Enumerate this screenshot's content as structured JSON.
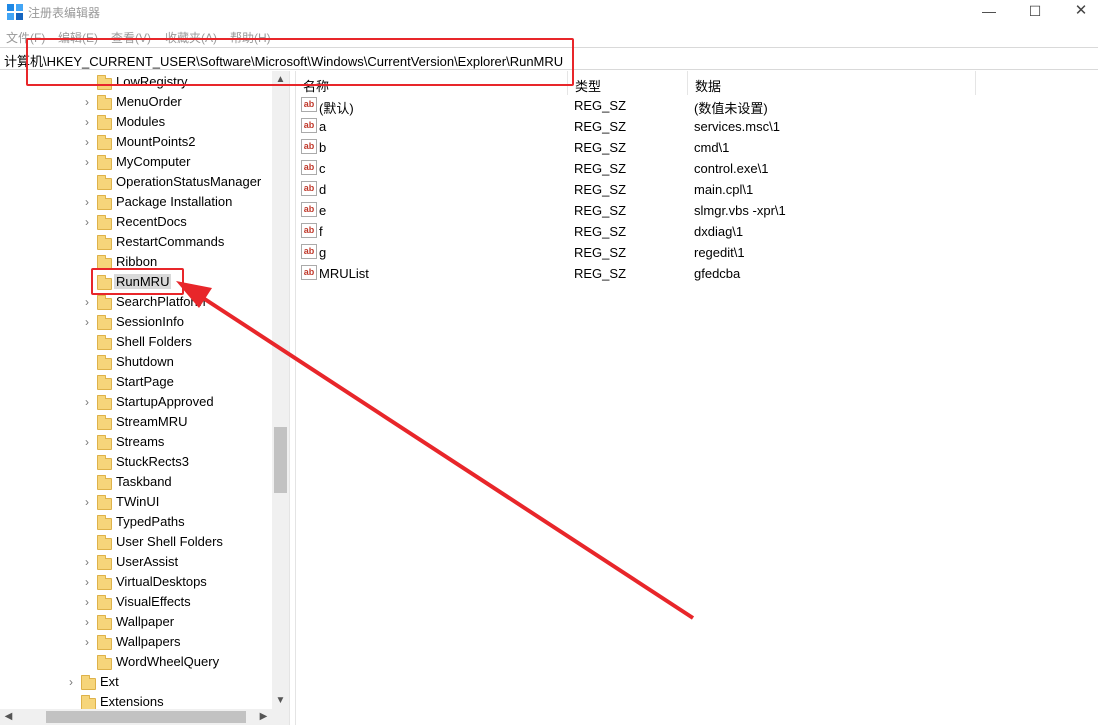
{
  "window": {
    "title": "注册表编辑器",
    "controls": {
      "minimize": "—",
      "maximize": "☐",
      "close": "✕"
    }
  },
  "menu": [
    "文件(F)",
    "编辑(E)",
    "查看(V)",
    "收藏夹(A)",
    "帮助(H)"
  ],
  "address": "计算机\\HKEY_CURRENT_USER\\Software\\Microsoft\\Windows\\CurrentVersion\\Explorer\\RunMRU",
  "tree": {
    "items": [
      {
        "label": "LowRegistry",
        "expandable": false
      },
      {
        "label": "MenuOrder",
        "expandable": true
      },
      {
        "label": "Modules",
        "expandable": true
      },
      {
        "label": "MountPoints2",
        "expandable": true
      },
      {
        "label": "MyComputer",
        "expandable": true
      },
      {
        "label": "OperationStatusManager",
        "expandable": false
      },
      {
        "label": "Package Installation",
        "expandable": true
      },
      {
        "label": "RecentDocs",
        "expandable": true
      },
      {
        "label": "RestartCommands",
        "expandable": false
      },
      {
        "label": "Ribbon",
        "expandable": false
      },
      {
        "label": "RunMRU",
        "expandable": false,
        "selected": true
      },
      {
        "label": "SearchPlatform",
        "expandable": true
      },
      {
        "label": "SessionInfo",
        "expandable": true
      },
      {
        "label": "Shell Folders",
        "expandable": false
      },
      {
        "label": "Shutdown",
        "expandable": false
      },
      {
        "label": "StartPage",
        "expandable": false
      },
      {
        "label": "StartupApproved",
        "expandable": true
      },
      {
        "label": "StreamMRU",
        "expandable": false
      },
      {
        "label": "Streams",
        "expandable": true
      },
      {
        "label": "StuckRects3",
        "expandable": false
      },
      {
        "label": "Taskband",
        "expandable": false
      },
      {
        "label": "TWinUI",
        "expandable": true
      },
      {
        "label": "TypedPaths",
        "expandable": false
      },
      {
        "label": "User Shell Folders",
        "expandable": false
      },
      {
        "label": "UserAssist",
        "expandable": true
      },
      {
        "label": "VirtualDesktops",
        "expandable": true
      },
      {
        "label": "VisualEffects",
        "expandable": true
      },
      {
        "label": "Wallpaper",
        "expandable": true
      },
      {
        "label": "Wallpapers",
        "expandable": true
      },
      {
        "label": "WordWheelQuery",
        "expandable": false
      }
    ],
    "parent_items": [
      {
        "label": "Ext",
        "expandable": true
      },
      {
        "label": "Extensions",
        "expandable": false
      }
    ]
  },
  "list": {
    "headers": {
      "name": "名称",
      "type": "类型",
      "data": "数据"
    },
    "value_icon": "ab",
    "rows": [
      {
        "name": "(默认)",
        "type": "REG_SZ",
        "data": "(数值未设置)"
      },
      {
        "name": "a",
        "type": "REG_SZ",
        "data": "services.msc\\1"
      },
      {
        "name": "b",
        "type": "REG_SZ",
        "data": "cmd\\1"
      },
      {
        "name": "c",
        "type": "REG_SZ",
        "data": "control.exe\\1"
      },
      {
        "name": "d",
        "type": "REG_SZ",
        "data": "main.cpl\\1"
      },
      {
        "name": "e",
        "type": "REG_SZ",
        "data": "slmgr.vbs -xpr\\1"
      },
      {
        "name": "f",
        "type": "REG_SZ",
        "data": "dxdiag\\1"
      },
      {
        "name": "g",
        "type": "REG_SZ",
        "data": "regedit\\1"
      },
      {
        "name": "MRUList",
        "type": "REG_SZ",
        "data": "gfedcba"
      }
    ]
  },
  "colors": {
    "annotation": "#e8262a",
    "selection": "#d9d9d9",
    "folder": "#f6d57a"
  }
}
